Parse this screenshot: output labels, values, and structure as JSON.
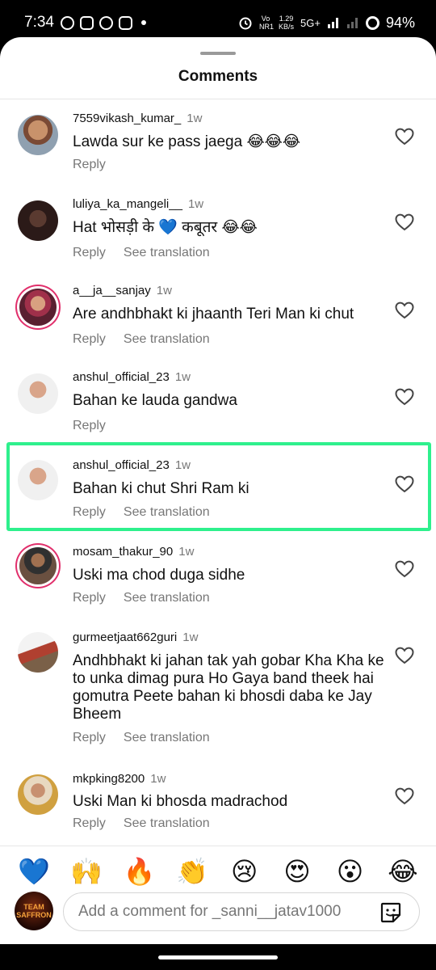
{
  "status_bar": {
    "time": "7:34",
    "net_speed_top": "1.29",
    "net_speed_bottom": "KB/s",
    "network": "5G+",
    "volte": "Vo NR1",
    "battery": "94%"
  },
  "sheet": {
    "title": "Comments"
  },
  "comments": [
    {
      "username": "7559vikash_kumar_",
      "age": "1w",
      "text": "Lawda sur ke pass jaega 😂😂😂",
      "reply": "Reply",
      "translate": ""
    },
    {
      "username": "luliya_ka_mangeli__",
      "age": "1w",
      "text": "Hat भोसड़ी के 💙 कबूतर 😂😂",
      "reply": "Reply",
      "translate": "See translation"
    },
    {
      "username": "a__ja__sanjay",
      "age": "1w",
      "text": "Are andhbhakt ki jhaanth Teri Man ki chut",
      "reply": "Reply",
      "translate": "See translation"
    },
    {
      "username": "anshul_official_23",
      "age": "1w",
      "text": "Bahan ke lauda gandwa",
      "reply": "Reply",
      "translate": ""
    },
    {
      "username": "anshul_official_23",
      "age": "1w",
      "text": "Bahan ki chut Shri Ram ki",
      "reply": "Reply",
      "translate": "See translation"
    },
    {
      "username": "mosam_thakur_90",
      "age": "1w",
      "text": "Uski ma chod duga sidhe",
      "reply": "Reply",
      "translate": "See translation"
    },
    {
      "username": "gurmeetjaat662guri",
      "age": "1w",
      "text": "Andhbhakt ki jahan tak yah gobar Kha Kha ke to unka dimag pura Ho Gaya band theek hai gomutra Peete bahan ki bhosdi daba ke Jay Bheem",
      "reply": "Reply",
      "translate": "See translation"
    },
    {
      "username": "mkpking8200",
      "age": "1w",
      "text": "Uski Man ki bhosda madrachod",
      "reply": "Reply",
      "translate": "See translation"
    }
  ],
  "reactions": [
    "💙",
    "🙌",
    "🔥",
    "👏",
    "😢",
    "😍",
    "😮",
    "😂"
  ],
  "composer": {
    "avatar_line1": "TEAM",
    "avatar_line2": "SAFFRON",
    "placeholder": "Add a comment for _sanni__jatav1000"
  },
  "colors": {
    "highlight": "#2ef08d",
    "story_ring": "#e1306c"
  },
  "icons": {
    "like": "heart-icon",
    "sticker": "sticker-icon"
  }
}
